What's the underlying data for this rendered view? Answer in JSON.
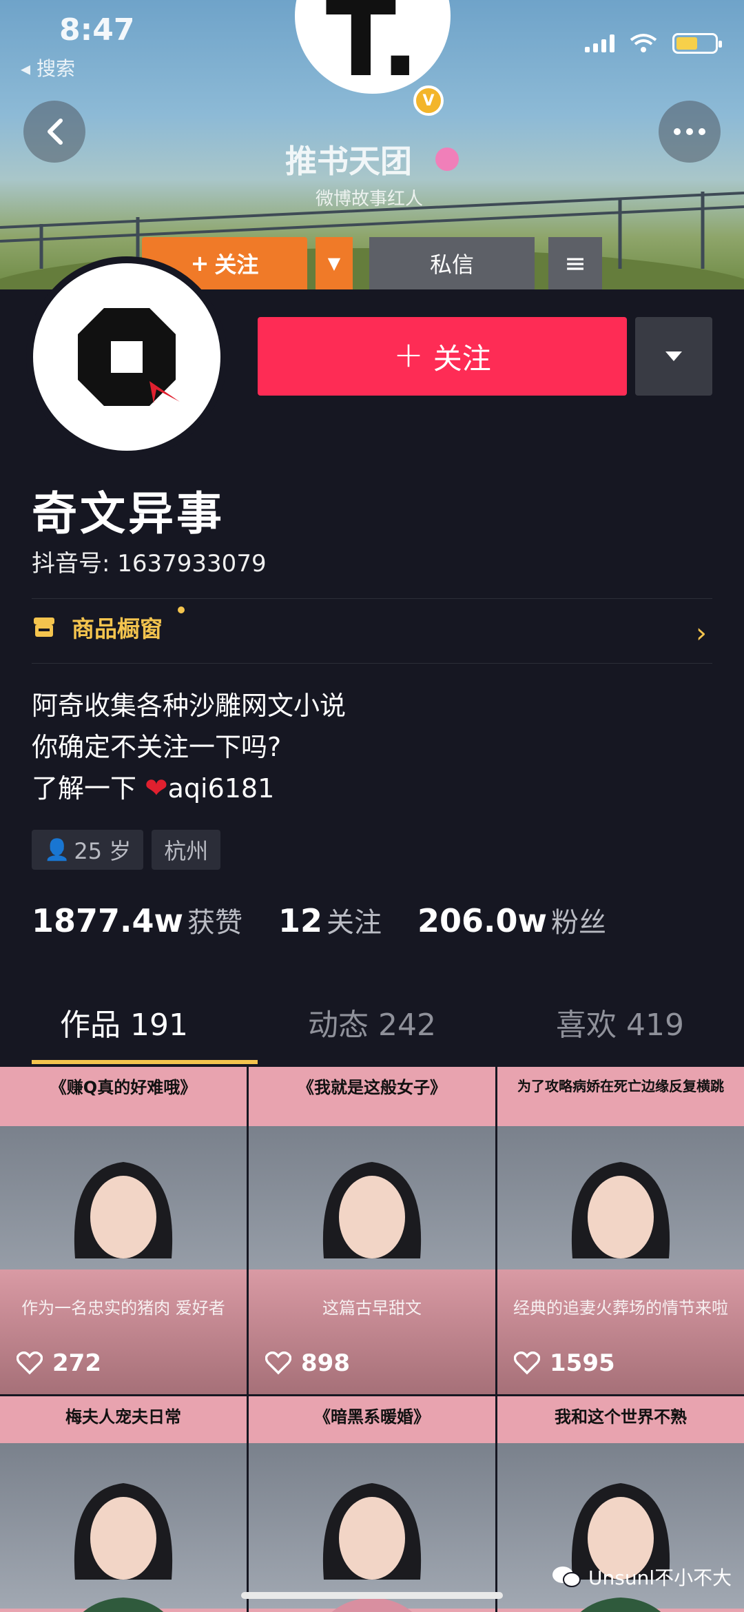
{
  "status_bar": {
    "time": "8:47",
    "back_app": "◂ 搜索"
  },
  "banner": {
    "avatar_letter": "T.",
    "verified_mark": "V",
    "name": "推书天团",
    "subtitle": "微博故事红人",
    "follow_label": "关注",
    "message_label": "私信"
  },
  "profile": {
    "name": "奇文异事",
    "douyin_id": "抖音号: 1637933079",
    "follow_label": "关注",
    "shop_label": "商品橱窗",
    "bio_line1": "阿奇收集各种沙雕网文小说",
    "bio_line2": "你确定不关注一下吗?",
    "bio_line3_prefix": "了解一下 ",
    "bio_line3_handle": "aqi6181",
    "tag_age": "25 岁",
    "tag_city": "杭州"
  },
  "stats": [
    {
      "num": "1877.4w",
      "label": "获赞"
    },
    {
      "num": "12",
      "label": "关注"
    },
    {
      "num": "206.0w",
      "label": "粉丝"
    }
  ],
  "tabs": [
    {
      "label": "作品 191"
    },
    {
      "label": "动态 242"
    },
    {
      "label": "喜欢 419"
    }
  ],
  "videos": [
    {
      "title": "《赚Q真的好难哦》",
      "subtitle": "作为一名忠实的猪肉 爱好者",
      "likes": "272",
      "shirt": "#7fb5e8"
    },
    {
      "title": "《我就是这般女子》",
      "subtitle": "这篇古早甜文",
      "likes": "898",
      "shirt": "#8cb9ec"
    },
    {
      "title": "为了攻略病娇在死亡边缘反复横跳",
      "subtitle": "经典的追妻火葬场的情节来啦",
      "likes": "1595",
      "shirt": "#2f5a3c"
    },
    {
      "title": "梅夫人宠夫日常",
      "subtitle": "",
      "likes": "",
      "shirt": "#2f5a3c"
    },
    {
      "title": "《暗黑系暖婚》",
      "subtitle": "",
      "likes": "",
      "shirt": "#d98fa0"
    },
    {
      "title": "我和这个世界不熟",
      "subtitle": "",
      "likes": "",
      "shirt": "#2f5a3c"
    }
  ],
  "watermark": "Unsunl不小不大",
  "colors": {
    "accent": "#fe2c55",
    "gold": "#f4c44e",
    "bg": "#161722"
  }
}
